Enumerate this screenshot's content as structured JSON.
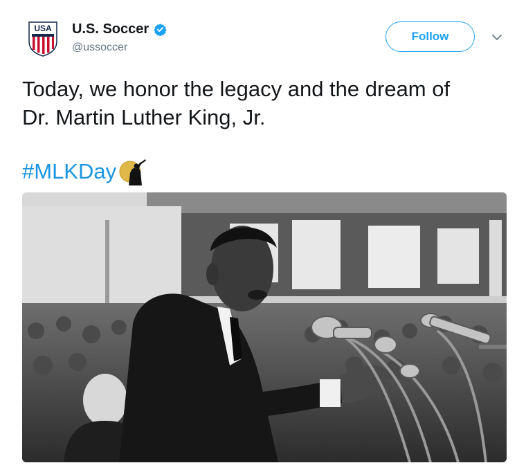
{
  "tweet": {
    "display_name": "U.S. Soccer",
    "handle": "@ussoccer",
    "follow_label": "Follow",
    "text_line1": "Today, we honor the legacy and the dream of",
    "text_line2": "Dr. Martin Luther King, Jr.",
    "hashtag": "#MLKDay",
    "avatar_logo_text": "USA"
  },
  "icons": {
    "verified": "verified-badge-icon",
    "caret": "chevron-down-icon",
    "hashflag": "mlk-hashflag-icon"
  },
  "colors": {
    "accent": "#1da1f2",
    "hashtag": "#1b95e0",
    "handle": "#657786",
    "text": "#14171a",
    "crest_red": "#c8102e",
    "crest_navy": "#13294b"
  }
}
